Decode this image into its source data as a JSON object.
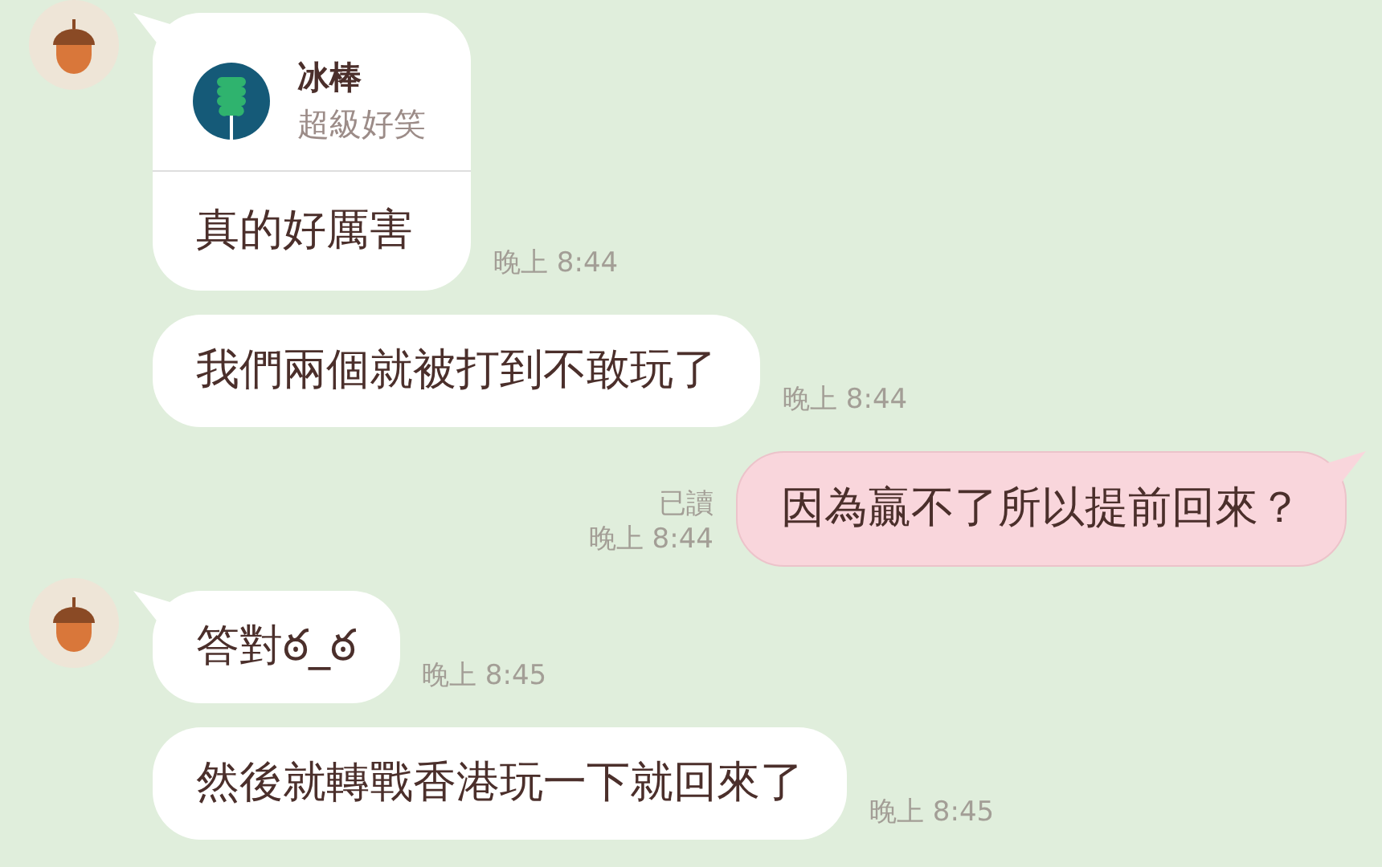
{
  "messages": [
    {
      "kind": "incoming",
      "show_avatar": true,
      "quote": {
        "name": "冰棒",
        "text": "超級好笑"
      },
      "text": "真的好厲害",
      "time": "晚上 8:44"
    },
    {
      "kind": "incoming",
      "show_avatar": false,
      "text": "我們兩個就被打到不敢玩了",
      "time": "晚上 8:44"
    },
    {
      "kind": "outgoing",
      "read": "已讀",
      "text": "因為贏不了所以提前回來？",
      "time": "晚上 8:44"
    },
    {
      "kind": "incoming",
      "show_avatar": true,
      "text": "答對ఠ_ఠ",
      "time": "晚上 8:45"
    },
    {
      "kind": "incoming",
      "show_avatar": false,
      "text": "然後就轉戰香港玩一下就回來了",
      "time": "晚上 8:45"
    }
  ]
}
